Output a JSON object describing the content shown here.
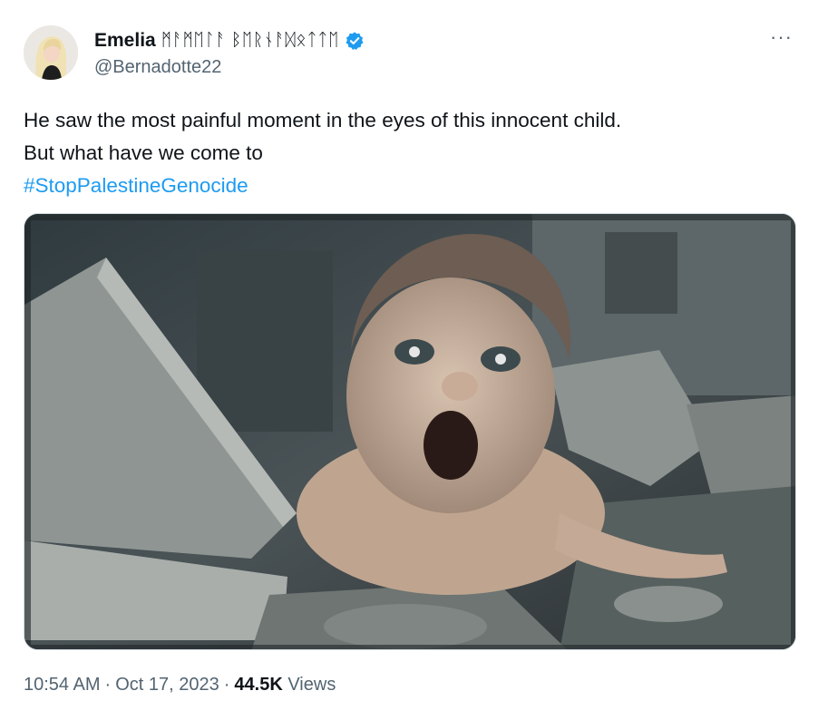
{
  "author": {
    "display_name": "Emelia",
    "name_suffix": "ᛗᚨᛗᛖᛚᚨ ᛒᛖᚱᚾᚨᛞᛟᛏᛏᛖ",
    "handle": "@Bernadotte22",
    "verified": true,
    "verified_color": "#1d9bf0"
  },
  "more_icon": "more-horizontal-icon",
  "more_label": "···",
  "tweet": {
    "lines": [
      "He saw the most painful moment in the eyes of this innocent child.",
      "But what have we come to"
    ],
    "hashtag": "#StopPalestineGenocide",
    "hashtag_color": "#1d9bf0"
  },
  "media": {
    "icon": "photo-image-icon"
  },
  "meta": {
    "time": "10:54 AM",
    "separator": "·",
    "date": "Oct 17, 2023",
    "views_count": "44.5K",
    "views_label": "Views"
  }
}
